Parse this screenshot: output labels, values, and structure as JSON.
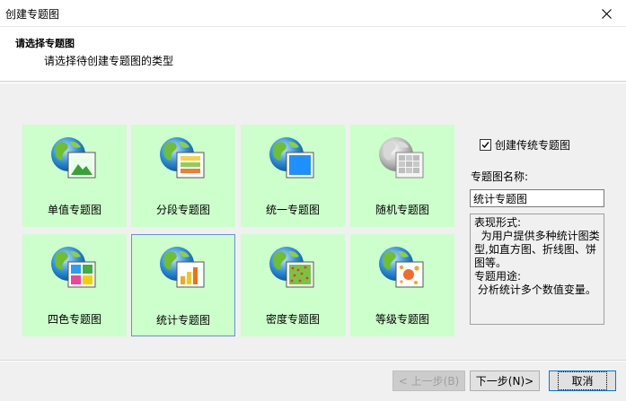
{
  "window": {
    "title": "创建专题图"
  },
  "header": {
    "heading": "请选择专题图",
    "subheading": "请选择待创建专题图的类型"
  },
  "tiles": [
    {
      "label": "单值专题图",
      "icon": "globe-picture-icon"
    },
    {
      "label": "分段专题图",
      "icon": "globe-ranges-icon"
    },
    {
      "label": "统一专题图",
      "icon": "globe-uniform-icon"
    },
    {
      "label": "随机专题图",
      "icon": "globe-random-icon"
    },
    {
      "label": "四色专题图",
      "icon": "globe-four-color-icon"
    },
    {
      "label": "统计专题图",
      "icon": "globe-chart-icon",
      "selected": true
    },
    {
      "label": "密度专题图",
      "icon": "globe-density-icon"
    },
    {
      "label": "等级专题图",
      "icon": "globe-graduated-icon"
    }
  ],
  "options": {
    "create_traditional_label": "创建传统专题图",
    "create_traditional_checked": true,
    "name_label": "专题图名称:",
    "name_value": "统计专题图"
  },
  "description": {
    "lines": [
      "表现形式:",
      "  为用户提供多种统计图类",
      "型,如直方图、折线图、饼",
      "图等。",
      "专题用途:",
      " 分析统计多个数值变量。"
    ]
  },
  "buttons": {
    "prev": "< 上一步(B)",
    "next": "下一步(N)>",
    "cancel": "取消"
  },
  "colors": {
    "tile_bg": "#ccffcc",
    "selected_border": "#6a8ed6"
  }
}
